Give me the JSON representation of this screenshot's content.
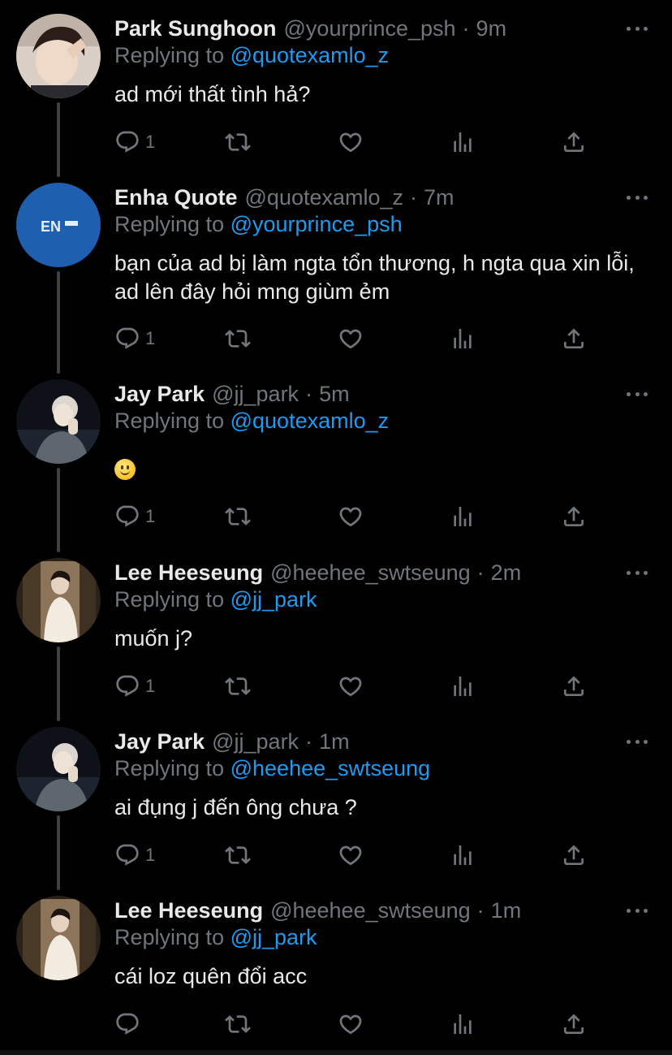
{
  "colors": {
    "background": "#000000",
    "text": "#e7e9ea",
    "muted": "#71767b",
    "accent": "#1d9bf0",
    "thread_line": "#3e4144"
  },
  "tweets": [
    {
      "name": "Park Sunghoon",
      "handle": "@yourprince_psh",
      "dot": "·",
      "time": "9m",
      "replying_prefix": "Replying to",
      "replying_to": "@quotexamlo_z",
      "text": "ad mới thất tình hả?",
      "reply_count": "1",
      "avatar_icon": "avatar-photo"
    },
    {
      "name": "Enha Quote",
      "handle": "@quotexamlo_z",
      "dot": "·",
      "time": "7m",
      "replying_prefix": "Replying to",
      "replying_to": "@yourprince_psh",
      "text": "bạn của ad bị làm ngta tổn thương, h ngta qua xin lỗi, ad lên đây hỏi mng giùm ẻm",
      "reply_count": "1",
      "avatar_logo": "EN"
    },
    {
      "name": "Jay Park",
      "handle": "@jj_park",
      "dot": "·",
      "time": "5m",
      "replying_prefix": "Replying to",
      "replying_to": "@quotexamlo_z",
      "text": "",
      "emoji": "slightly-smiling-face-icon",
      "reply_count": "1",
      "avatar_icon": "avatar-photo"
    },
    {
      "name": "Lee Heeseung",
      "handle": "@heehee_swtseung",
      "dot": "·",
      "time": "2m",
      "replying_prefix": "Replying to",
      "replying_to": "@jj_park",
      "text": "muốn j?",
      "reply_count": "1",
      "avatar_icon": "avatar-photo"
    },
    {
      "name": "Jay Park",
      "handle": "@jj_park",
      "dot": "·",
      "time": "1m",
      "replying_prefix": "Replying to",
      "replying_to": "@heehee_swtseung",
      "text": "ai đụng j đến ông chưa ?",
      "reply_count": "1",
      "avatar_icon": "avatar-photo"
    },
    {
      "name": "Lee Heeseung",
      "handle": "@heehee_swtseung",
      "dot": "·",
      "time": "1m",
      "replying_prefix": "Replying to",
      "replying_to": "@jj_park",
      "text": "cái loz quên đổi acc",
      "reply_count": "",
      "avatar_icon": "avatar-photo"
    }
  ],
  "action_icons": [
    "reply-icon",
    "retweet-icon",
    "like-icon",
    "views-icon",
    "share-icon"
  ]
}
